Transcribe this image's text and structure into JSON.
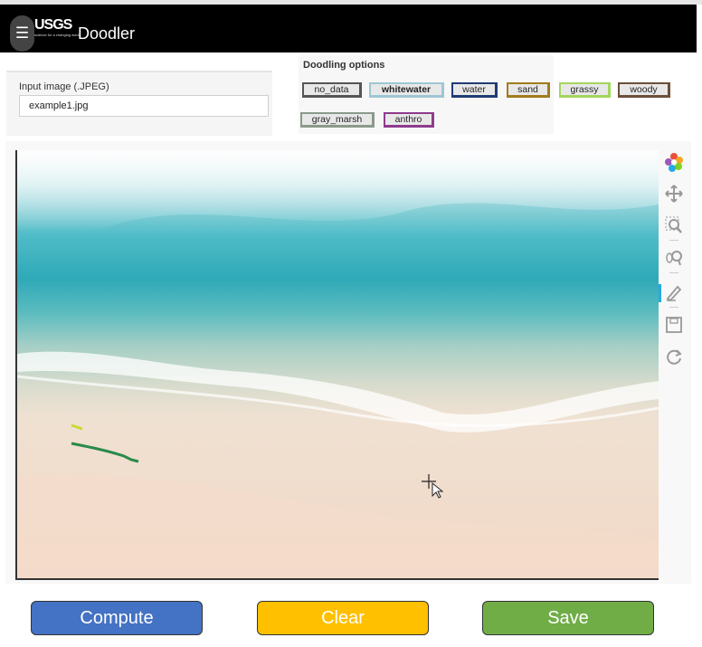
{
  "header": {
    "app_title": "Doodler",
    "logo_text": "USGS",
    "logo_tagline": "science for a changing world",
    "menu_icon": "hamburger-icon"
  },
  "input_panel": {
    "label": "Input image (.JPEG)",
    "value": "example1.jpg"
  },
  "options": {
    "title": "Doodling options",
    "classes": [
      {
        "label": "no_data",
        "color": "#555555"
      },
      {
        "label": "whitewater",
        "color": "#9ec7d3"
      },
      {
        "label": "water",
        "color": "#1f3b73"
      },
      {
        "label": "sand",
        "color": "#a07c1e"
      },
      {
        "label": "grassy",
        "color": "#a4d65e"
      },
      {
        "label": "woody",
        "color": "#6b4f3a"
      },
      {
        "label": "gray_marsh",
        "color": "#8a9a8a"
      },
      {
        "label": "anthro",
        "color": "#8e3b8e"
      }
    ]
  },
  "toolbar": {
    "tools": [
      "bokeh-logo-icon",
      "pan-icon",
      "box-zoom-icon",
      "wheel-zoom-icon",
      "freehand-draw-icon",
      "save-icon",
      "reset-icon"
    ],
    "active": "freehand-draw-icon",
    "active_color": "#26aae1"
  },
  "doodles": [
    {
      "class": "grassy",
      "color": "#c9d930"
    },
    {
      "class": "sand",
      "color": "#2a8a4a"
    }
  ],
  "actions": {
    "compute": {
      "label": "Compute",
      "color": "#4472c4"
    },
    "clear": {
      "label": "Clear",
      "color": "#ffc000"
    },
    "save": {
      "label": "Save",
      "color": "#70ad47"
    }
  }
}
